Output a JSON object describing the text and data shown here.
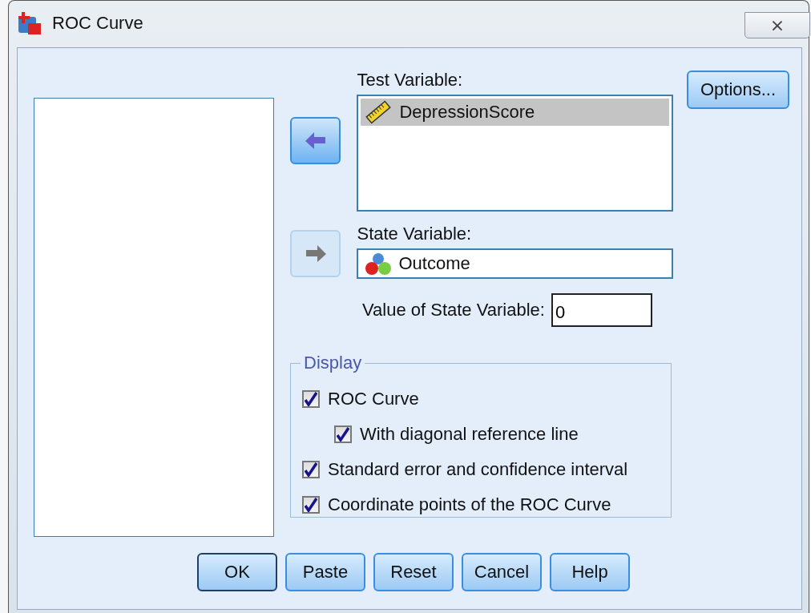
{
  "window": {
    "title": "ROC Curve",
    "close_label": "⨯"
  },
  "test_variable": {
    "label": "Test Variable:",
    "items": [
      {
        "name": "DepressionScore",
        "kind": "scale",
        "selected": true
      }
    ]
  },
  "arrows": [
    {
      "disabled": false
    },
    {
      "disabled": true
    }
  ],
  "state_variable": {
    "label": "State Variable:",
    "value": "Outcome",
    "kind": "nominal"
  },
  "state_value": {
    "label": "Value of State Variable:",
    "value": "0"
  },
  "display": {
    "title": "Display",
    "options": [
      {
        "label": "ROC Curve",
        "checked": true,
        "indented": false
      },
      {
        "label": "With diagonal reference line",
        "checked": true,
        "indented": true
      },
      {
        "label": "Standard error and confidence interval",
        "checked": true,
        "indented": false
      },
      {
        "label": "Coordinate points of the ROC Curve",
        "checked": true,
        "indented": false
      }
    ]
  },
  "options_button": "Options...",
  "buttons": [
    {
      "label": "OK",
      "default": true
    },
    {
      "label": "Paste",
      "default": false
    },
    {
      "label": "Reset",
      "default": false
    },
    {
      "label": "Cancel",
      "default": false
    },
    {
      "label": "Help",
      "default": false
    }
  ]
}
